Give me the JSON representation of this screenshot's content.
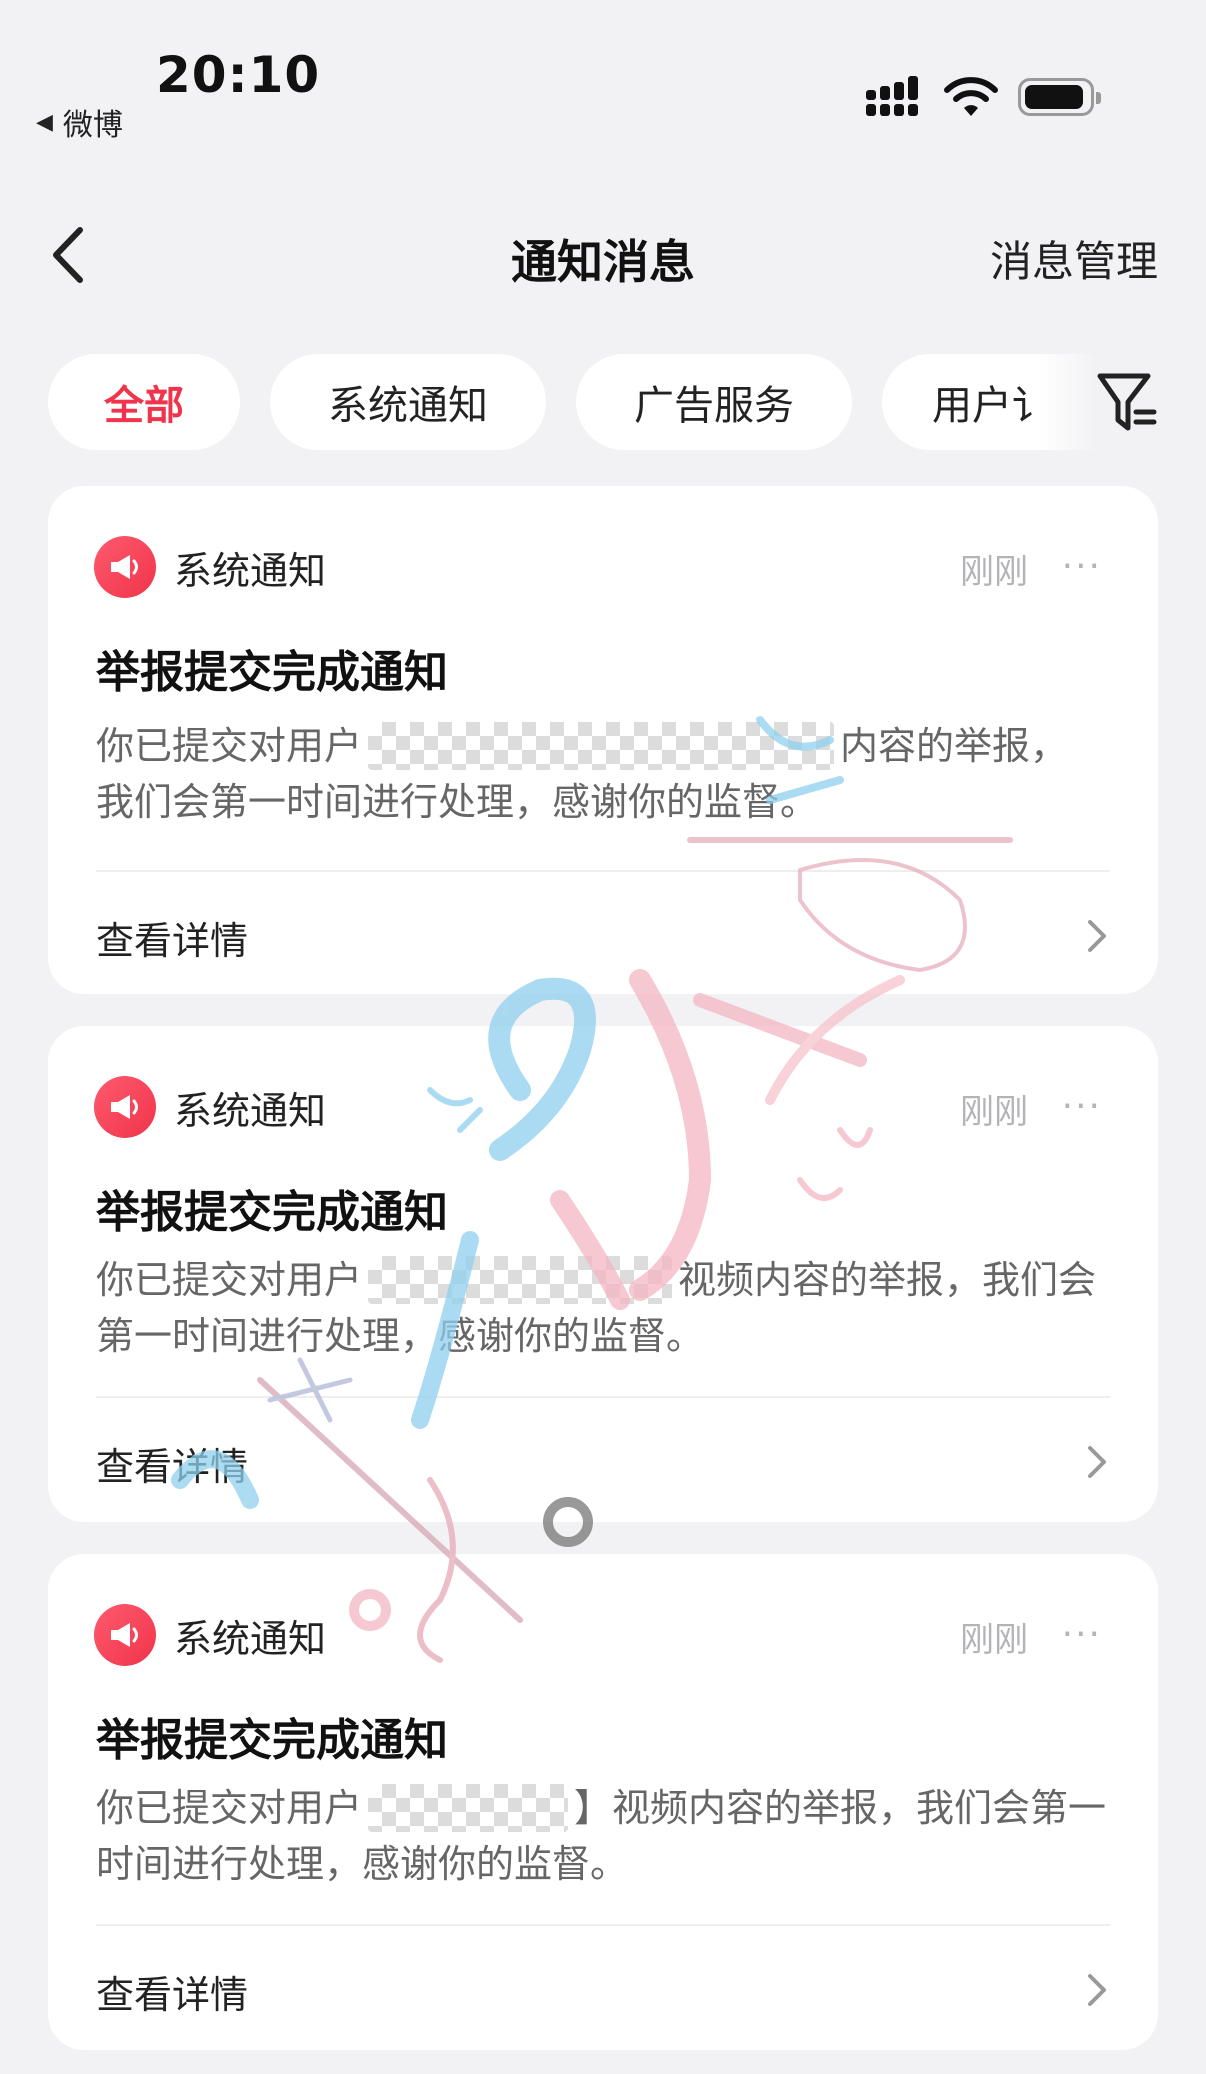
{
  "status_bar": {
    "time": "20:10",
    "back_app": "微博",
    "back_icon": "back-triangle-icon"
  },
  "nav": {
    "title": "通知消息",
    "manage": "消息管理"
  },
  "tabs": [
    {
      "label": "全部",
      "active": true
    },
    {
      "label": "系统通知",
      "active": false
    },
    {
      "label": "广告服务",
      "active": false
    },
    {
      "label": "用户讠",
      "active": false
    }
  ],
  "accent_color": "#f0344b",
  "cards": [
    {
      "category": "系统通知",
      "time": "刚刚",
      "more": "···",
      "title": "举报提交完成通知",
      "body_prefix": "你已提交对用户",
      "body_mid": "内容的举报，",
      "body_line2": "我们会第一时间进行处理，感谢你的监督。",
      "detail": "查看详情"
    },
    {
      "category": "系统通知",
      "time": "刚刚",
      "more": "···",
      "title": "举报提交完成通知",
      "body_prefix": "你已提交对用户",
      "body_mid": "视频内容的举报，我们会",
      "body_line2": "第一时间进行处理，感谢你的监督。",
      "detail": "查看详情"
    },
    {
      "category": "系统通知",
      "time": "刚刚",
      "more": "···",
      "title": "举报提交完成通知",
      "body_prefix": "你已提交对用户",
      "body_mid": "】视频内容的举报，我们会第一",
      "body_line2": "时间进行处理，感谢你的监督。",
      "detail": "查看详情"
    }
  ]
}
